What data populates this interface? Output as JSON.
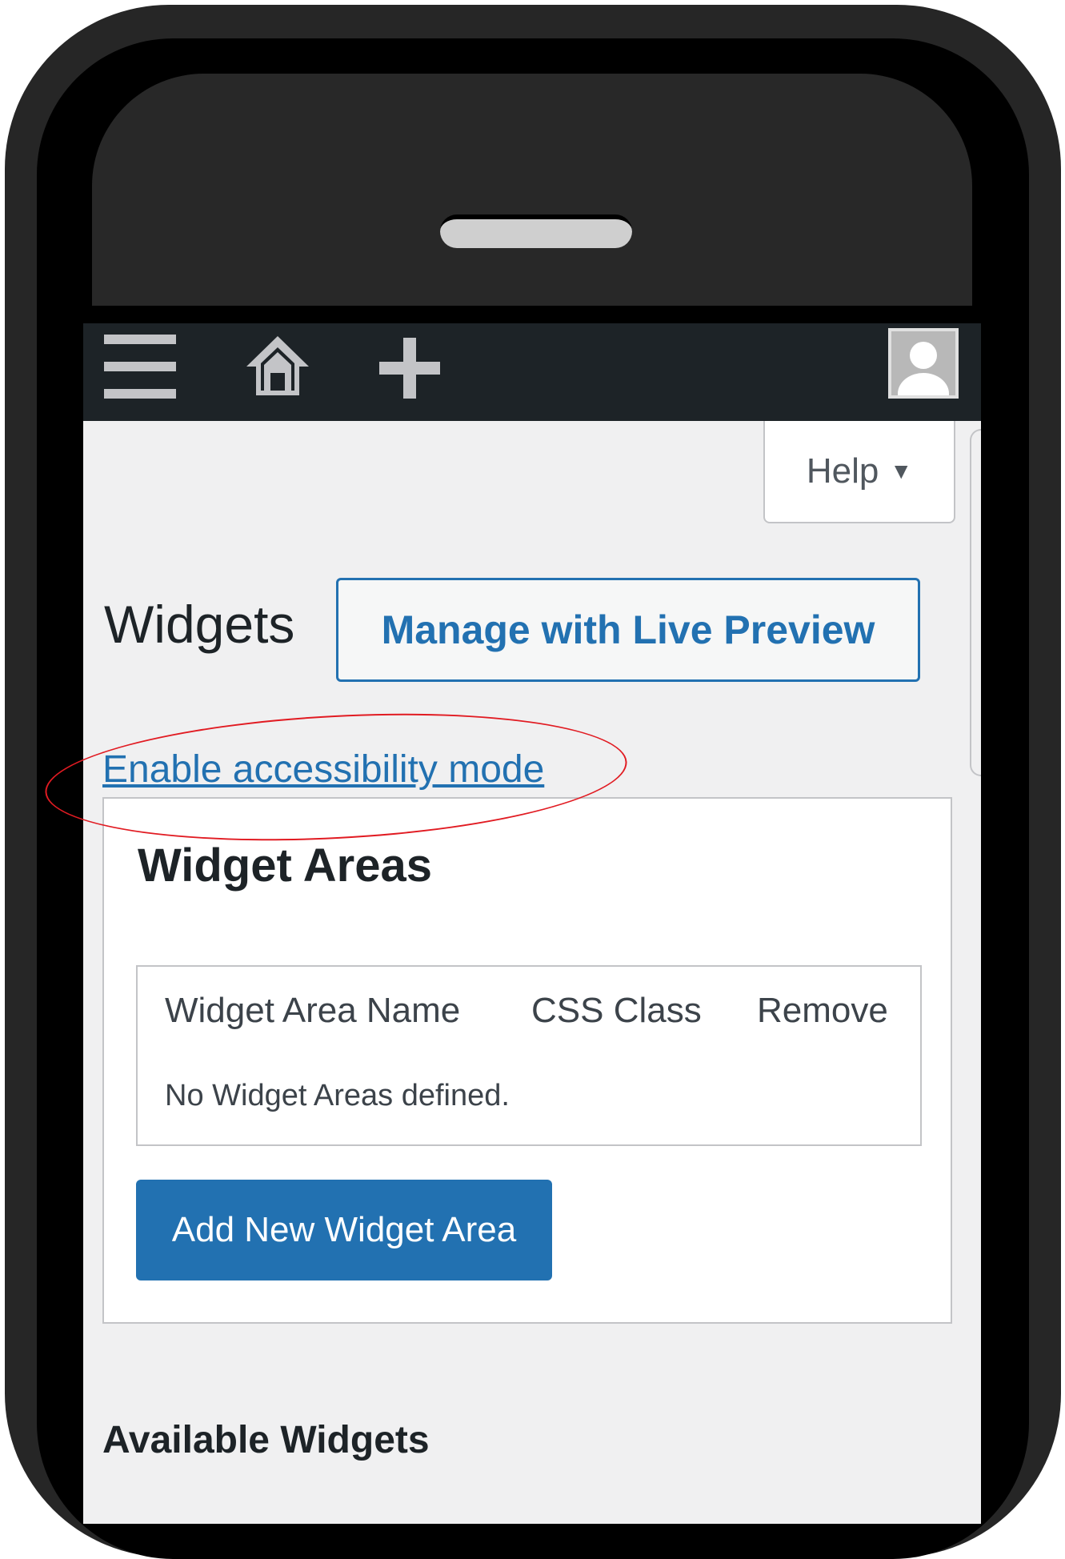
{
  "admin_bar": {
    "menu_icon": "hamburger-menu-icon",
    "home_icon": "house-icon",
    "add_icon": "plus-icon",
    "avatar": "user-avatar"
  },
  "help_tab": {
    "label": "Help",
    "caret": "▼"
  },
  "page": {
    "title": "Widgets",
    "live_preview_button": "Manage with Live Preview",
    "accessibility_link": "Enable accessibility mode"
  },
  "widget_areas": {
    "title": "Widget Areas",
    "columns": [
      "Widget Area Name",
      "CSS Class",
      "Remove"
    ],
    "empty_message": "No Widget Areas defined.",
    "add_button": "Add New Widget Area"
  },
  "available_widgets": {
    "title": "Available Widgets"
  },
  "colors": {
    "accent": "#2271b1",
    "admin_bar": "#1d2327",
    "background": "#f0f0f1",
    "annotation": "#e11b22"
  }
}
